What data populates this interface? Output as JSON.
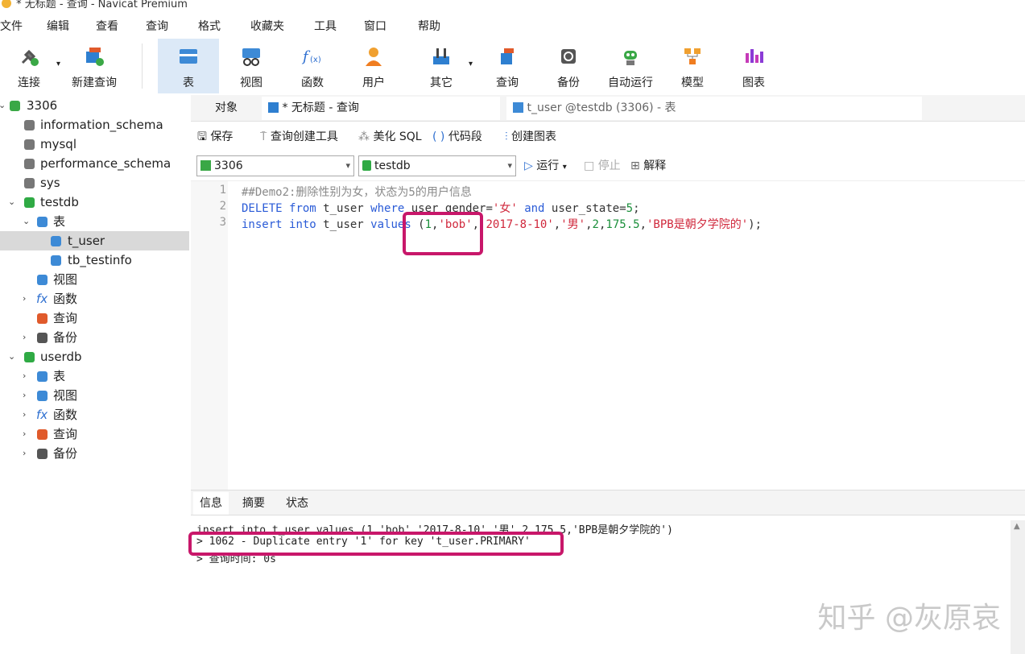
{
  "window": {
    "title": "* 无标题 - 查询 - Navicat Premium"
  },
  "menu": [
    "文件",
    "编辑",
    "查看",
    "查询",
    "格式",
    "收藏夹",
    "工具",
    "窗口",
    "帮助"
  ],
  "toolbar": [
    {
      "label": "连接",
      "icon": "plug-icon"
    },
    {
      "label": "新建查询",
      "icon": "new-query-icon"
    },
    {
      "label": "表",
      "icon": "table-icon"
    },
    {
      "label": "视图",
      "icon": "view-icon"
    },
    {
      "label": "函数",
      "icon": "function-icon"
    },
    {
      "label": "用户",
      "icon": "user-icon"
    },
    {
      "label": "其它",
      "icon": "other-icon"
    },
    {
      "label": "查询",
      "icon": "query-icon"
    },
    {
      "label": "备份",
      "icon": "backup-icon"
    },
    {
      "label": "自动运行",
      "icon": "robot-icon"
    },
    {
      "label": "模型",
      "icon": "model-icon"
    },
    {
      "label": "图表",
      "icon": "chart-icon"
    }
  ],
  "sidebar": {
    "items": [
      {
        "label": "3306"
      },
      {
        "label": "information_schema"
      },
      {
        "label": "mysql"
      },
      {
        "label": "performance_schema"
      },
      {
        "label": "sys"
      },
      {
        "label": "testdb"
      },
      {
        "label": "表"
      },
      {
        "label": "t_user"
      },
      {
        "label": "tb_testinfo"
      },
      {
        "label": "视图"
      },
      {
        "label": "函数"
      },
      {
        "label": "查询"
      },
      {
        "label": "备份"
      },
      {
        "label": "userdb"
      },
      {
        "label": "表"
      },
      {
        "label": "视图"
      },
      {
        "label": "函数"
      },
      {
        "label": "查询"
      },
      {
        "label": "备份"
      }
    ]
  },
  "tabs": {
    "objects": "对象",
    "query": "* 无标题 - 查询",
    "table": "t_user @testdb (3306) - 表"
  },
  "query_toolbar": {
    "save": "保存",
    "builder": "查询创建工具",
    "beautify": "美化 SQL",
    "snippet": "代码段",
    "create_chart": "创建图表"
  },
  "selectors": {
    "connection": "3306",
    "database": "testdb",
    "run": "运行",
    "stop": "停止",
    "explain": "解释"
  },
  "editor": {
    "line_numbers": [
      "1",
      "2",
      "3"
    ],
    "line1": "##Demo2:删除性别为女，状态为5的用户信息",
    "line2": {
      "kw1": "DELETE",
      "kw2": "from",
      "t1": " t_user ",
      "kw3": "where",
      "t2": " user_gender=",
      "s1": "'女'",
      "t3": " ",
      "kw4": "and",
      "t4": " user_state=",
      "n1": "5",
      "t5": ";"
    },
    "line3": {
      "kw1": "insert",
      "kw2": "into",
      "t1": " t_user ",
      "kw3": "values",
      "t2": " (",
      "n1": "1",
      "t3": ",",
      "s1": "'bob'",
      "t4": ",",
      "s2": "'2017-8-10'",
      "t5": ",",
      "s3": "'男'",
      "t6": ",",
      "n2": "2",
      "t7": ",",
      "n3": "175.5",
      "t8": ",",
      "s4": "'BPB是朝夕学院的'",
      "t9": ");"
    }
  },
  "result_tabs": [
    "信息",
    "摘要",
    "状态"
  ],
  "output": {
    "line1": "insert into t_user values (1,'bob','2017-8-10','男',2,175.5,'BPB是朝夕学院的')",
    "line2": "> 1062 - Duplicate entry '1' for key 't_user.PRIMARY'",
    "line3": "> 查询时间: 0s"
  },
  "watermark": "知乎 @灰原哀",
  "colors": {
    "highlight": "#c8176a",
    "keyword": "#2a5bd7",
    "string": "#d0283c",
    "number": "#1a8f3a",
    "active_tool": "#dce9f7"
  }
}
